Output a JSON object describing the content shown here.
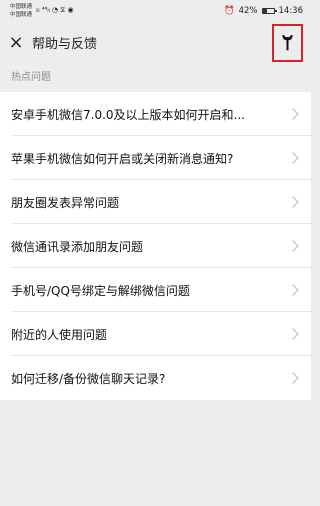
{
  "status_bar": {
    "carrier_1": "中国联通",
    "carrier_2": "中国联通",
    "network_glyphs": "ᵢₗₗ ⁴⁶ₗₗ ◔ ⧖ ◉",
    "alarm_icon": "alarm-icon",
    "battery_level": "42%",
    "battery_fill": 0.42,
    "time": "14:36"
  },
  "header": {
    "close_icon": "close-icon",
    "title": "帮助与反馈",
    "wrench_icon": "wrench-icon",
    "highlight_color": "#d4242e"
  },
  "section": {
    "label": "热点问题"
  },
  "faq_items": [
    {
      "label": "安卓手机微信7.0.0及以上版本如何开启和..."
    },
    {
      "label": "苹果手机微信如何开启或关闭新消息通知?"
    },
    {
      "label": "朋友圈发表异常问题"
    },
    {
      "label": "微信通讯录添加朋友问题"
    },
    {
      "label": "手机号/QQ号绑定与解绑微信问题"
    },
    {
      "label": "附近的人使用问题"
    },
    {
      "label": "如何迁移/备份微信聊天记录?"
    }
  ]
}
